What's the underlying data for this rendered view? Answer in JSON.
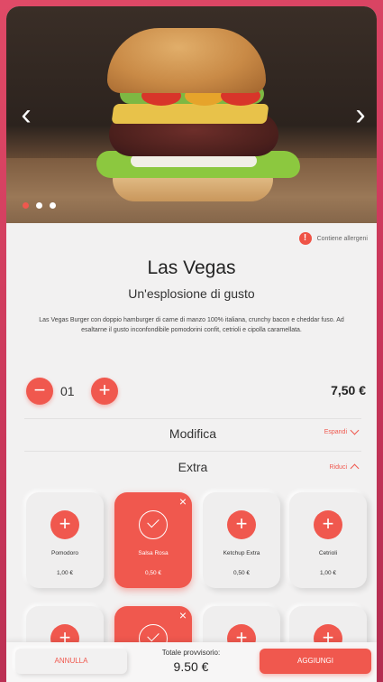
{
  "hero": {
    "prev_icon": "chevron-left-icon",
    "next_icon": "chevron-right-icon",
    "slides_total": 3,
    "active_slide": 1
  },
  "allergens": {
    "icon": "alert-icon",
    "label": "Contiene allergeni"
  },
  "product": {
    "title": "Las Vegas",
    "subtitle": "Un'esplosione di gusto",
    "description": "Las Vegas Burger con doppio hamburger di carne di manzo 100% italiana, crunchy bacon e cheddar fuso. Ad esaltarne il gusto inconfondibile pomodorini confit, cetrioli e cipolla caramellata.",
    "quantity": "01",
    "price": "7,50 €"
  },
  "sections": {
    "modifica": {
      "label": "Modifica",
      "toggle": "Espandi"
    },
    "extra": {
      "label": "Extra",
      "toggle": "Riduci"
    }
  },
  "extras": [
    {
      "name": "Pomodoro",
      "price": "1,00 €",
      "selected": false
    },
    {
      "name": "Salsa Rosa",
      "price": "0,50 €",
      "selected": true
    },
    {
      "name": "Ketchup Extra",
      "price": "0,50 €",
      "selected": false
    },
    {
      "name": "Cetrioli",
      "price": "1,00 €",
      "selected": false
    }
  ],
  "extras_row2_selected": [
    false,
    true,
    false,
    false
  ],
  "footer": {
    "cancel_label": "ANNULLA",
    "total_label": "Totale provvisorio:",
    "total_value": "9.50 €",
    "add_label": "AGGIUNGI"
  },
  "colors": {
    "accent": "#f0584e",
    "background": "#f2f1f1",
    "frame": "#d63e60"
  }
}
